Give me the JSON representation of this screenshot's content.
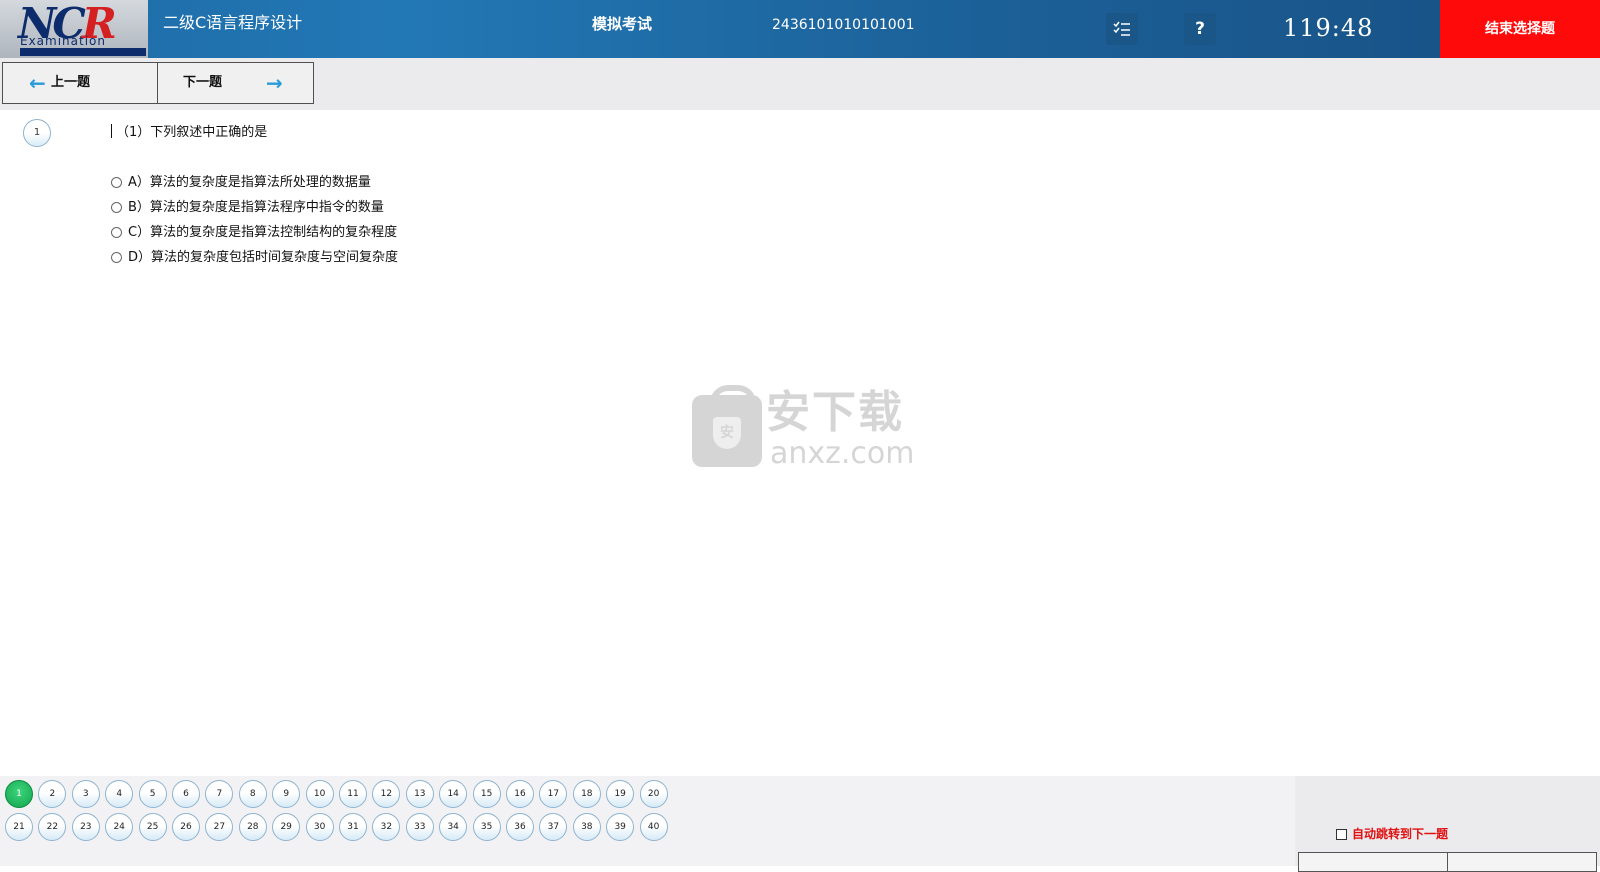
{
  "header": {
    "logo": {
      "mark": "NCR",
      "sub": "Examination"
    },
    "app_title": "二级C语言程序设计",
    "mode_title": "模拟考试",
    "exam_id": "2436101010101001",
    "list_icon": "list-check-icon",
    "help_label": "?",
    "timer": "119:48",
    "end_button": "结束选择题",
    "end_button_color": "#ff0a0a"
  },
  "nav": {
    "prev_label": "上一题",
    "next_label": "下一题",
    "arrow_color": "#2a9bd8"
  },
  "question": {
    "number_badge": "1",
    "text": "（1）下列叙述中正确的是",
    "options": [
      {
        "label": "A）算法的复杂度是指算法所处理的数据量",
        "selected": false
      },
      {
        "label": "B）算法的复杂度是指算法程序中指令的数量",
        "selected": false
      },
      {
        "label": "C）算法的复杂度是指算法控制结构的复杂程度",
        "selected": false
      },
      {
        "label": "D）算法的复杂度包括时间复杂度与空间复杂度",
        "selected": false
      }
    ]
  },
  "watermark": {
    "cn": "安下载",
    "en": "anxz.com",
    "badge": "安"
  },
  "footer": {
    "questions": [
      "1",
      "2",
      "3",
      "4",
      "5",
      "6",
      "7",
      "8",
      "9",
      "10",
      "11",
      "12",
      "13",
      "14",
      "15",
      "16",
      "17",
      "18",
      "19",
      "20",
      "21",
      "22",
      "23",
      "24",
      "25",
      "26",
      "27",
      "28",
      "29",
      "30",
      "31",
      "32",
      "33",
      "34",
      "35",
      "36",
      "37",
      "38",
      "39",
      "40"
    ],
    "current": "1",
    "active_color": "#11a44e",
    "auto_jump_label": "自动跳转到下一题",
    "auto_jump_checked": false
  }
}
